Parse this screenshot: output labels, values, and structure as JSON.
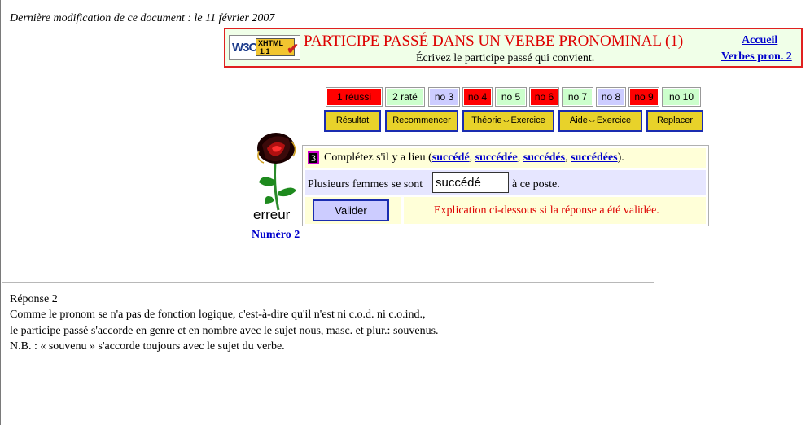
{
  "header": {
    "modified": "Dernière modification de ce document : le 11 février 2007",
    "title": "PARTICIPE PASSÉ DANS UN VERBE PRONOMINAL (1)",
    "subtitle": "Écrivez le participe passé qui convient.",
    "link_home": "Accueil",
    "link_verbs": "Verbes pron. 2",
    "badge_brand": "W3C",
    "badge_line1": "XHTML",
    "badge_line2": "1.1"
  },
  "question_buttons": [
    {
      "label": "1 réussi",
      "status": "red"
    },
    {
      "label": "2 raté",
      "status": "green"
    },
    {
      "label": "no 3",
      "status": "lilac"
    },
    {
      "label": "no 4",
      "status": "red"
    },
    {
      "label": "no 5",
      "status": "green"
    },
    {
      "label": "no 6",
      "status": "red"
    },
    {
      "label": "no 7",
      "status": "green"
    },
    {
      "label": "no 8",
      "status": "lilac"
    },
    {
      "label": "no 9",
      "status": "red"
    },
    {
      "label": "no 10",
      "status": "green"
    }
  ],
  "actions": {
    "result": "Résultat",
    "restart": "Recommencer",
    "theory": "Théorie⇔Exercice",
    "help": "Aide⇔Exercice",
    "replace": "Replacer"
  },
  "feedback": {
    "status": "erreur",
    "number_link": "Numéro 2"
  },
  "exercise": {
    "number": "3",
    "instruction_prefix": "Complétez s'il y a lieu (",
    "choices": [
      "succédé",
      "succédée",
      "succédés",
      "succédées"
    ],
    "instruction_suffix": ").",
    "sentence_before": "Plusieurs femmes se sont",
    "answer_value": "succédé",
    "sentence_after": "à ce poste.",
    "validate": "Valider",
    "explanation": "Explication ci-dessous si la réponse a été validée."
  },
  "answer": {
    "heading": "Réponse 2",
    "line1": "Comme le pronom se n'a pas de fonction logique, c'est-à-dire qu'il n'est ni c.o.d. ni c.o.ind.,",
    "line2": "le participe passé s'accorde en genre et en nombre avec le sujet nous, masc. et plur.: souvenus.",
    "line3": "N.B. : « souvenu » s'accorde toujours avec le sujet du verbe."
  },
  "colors": {
    "red": "#ff0000",
    "green": "#ccffcc",
    "lilac": "#ccccff",
    "action_yellow": "#e8d22a",
    "link_blue": "#0000cc"
  }
}
